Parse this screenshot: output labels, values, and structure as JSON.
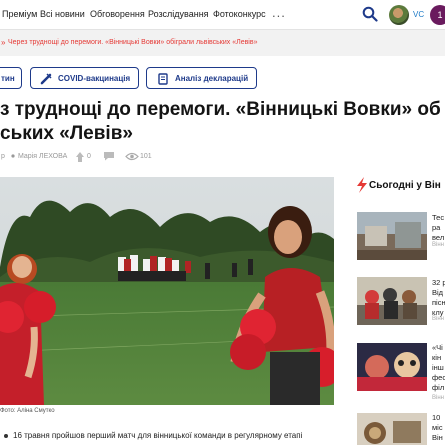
{
  "nav": {
    "items": [
      "Преміум",
      "Всі новини",
      "Обговорення",
      "Розслідування",
      "Фотоконкурс"
    ],
    "more": "...",
    "user_label": "VC",
    "badge": "1"
  },
  "breadcrumb": {
    "separator": "»",
    "text": "Через труднощі до перемоги. «Вінницькі Вовки» обіграли львівських «Левів»"
  },
  "tags": [
    {
      "label": "тин",
      "icon": "none"
    },
    {
      "label": "COVID-вакцинація",
      "icon": "syringe-icon"
    },
    {
      "label": "Аналіз декларацій",
      "icon": "document-icon"
    }
  ],
  "article": {
    "headline_line1": "з труднощі до перемоги. «Вінницькі Вовки» об",
    "headline_line2": "ських «Левів»",
    "date_fragment": "р",
    "author": "Марія ЛЕХОВА",
    "likes": "0",
    "comments": "",
    "views": "101",
    "photo_caption": "Фото: Аліна Смутко",
    "lead": "16 травня пройшов перший матч для вінницької команди в регулярному етапі"
  },
  "sidebar": {
    "title": "Сьогодні у Він",
    "items": [
      {
        "lines": [
          "Тес",
          "ра",
          "вел"
        ],
        "source": "Вінн"
      },
      {
        "lines": [
          "32 р",
          "Від",
          "пісн",
          "клу"
        ],
        "source": "Вінн"
      },
      {
        "lines": [
          "«Чі",
          "кін",
          "інш",
          "фес",
          "філ"
        ],
        "source": "Вінн"
      },
      {
        "lines": [
          "10",
          "міс",
          "Він"
        ],
        "source": ""
      }
    ]
  },
  "colors": {
    "accent_red": "#e53935",
    "nav_blue": "#1e3a8a",
    "badge_purple": "#6a1b5e"
  }
}
